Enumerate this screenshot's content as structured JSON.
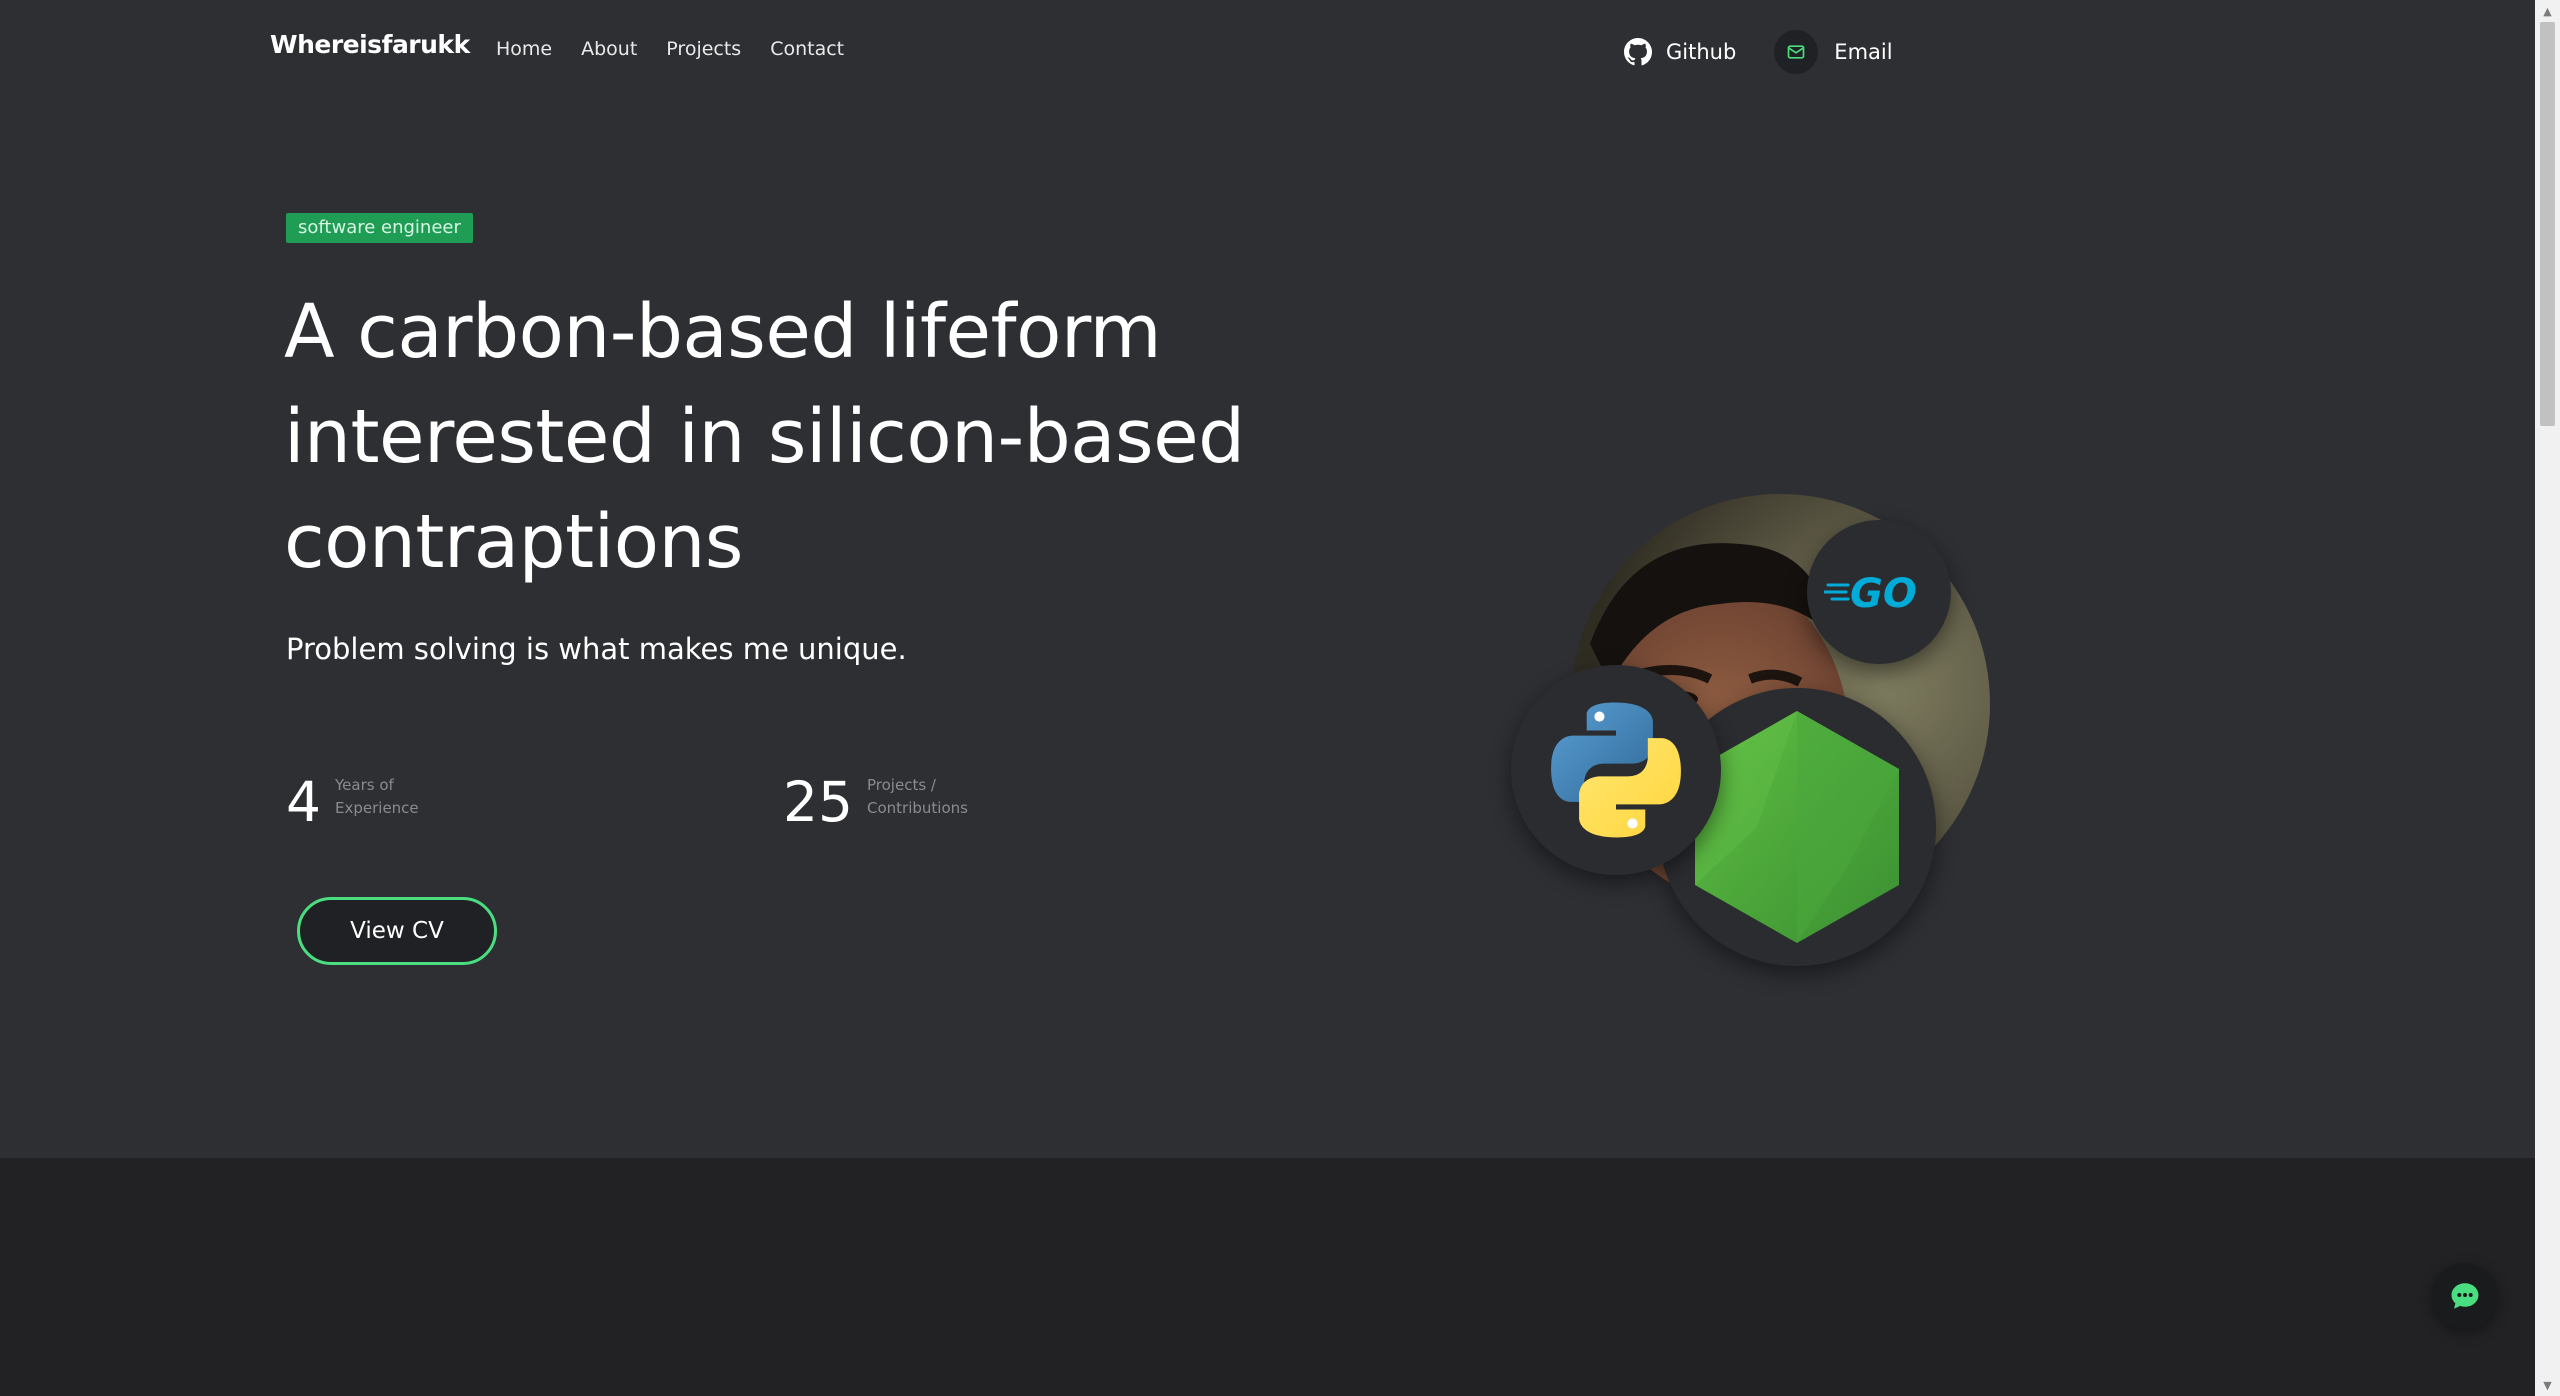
{
  "nav": {
    "brand": "Whereisfarukk",
    "links": [
      "Home",
      "About",
      "Projects",
      "Contact"
    ],
    "github_label": "Github",
    "email_label": "Email"
  },
  "hero": {
    "badge": "software engineer",
    "headline_lines": [
      "A carbon-based lifeform",
      "interested in silicon-based",
      "contraptions"
    ],
    "subhead": "Problem solving is what makes me unique.",
    "stats": [
      {
        "value": "4",
        "label": "Years of Experience"
      },
      {
        "value": "25",
        "label": "Projects / Contributions"
      }
    ],
    "cv_button": "View CV"
  },
  "tech_badges": {
    "go_text": "GO"
  },
  "icons": {
    "github": "github-icon",
    "email": "mail-icon",
    "python": "python-icon",
    "go": "go-icon",
    "node": "nodejs-icon",
    "chat": "chat-icon"
  },
  "colors": {
    "background": "#2e2f33",
    "lower_section": "#222225",
    "accent_green": "#4ade80",
    "badge_green": "#1f9d55",
    "go_blue": "#00acd7",
    "node_green": "#3fa33f"
  }
}
